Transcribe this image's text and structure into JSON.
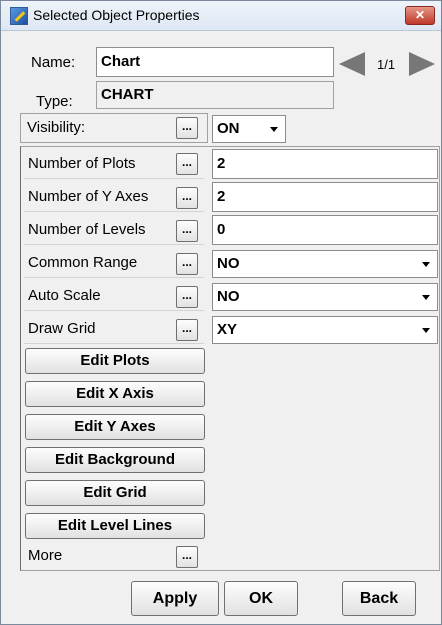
{
  "window": {
    "title": "Selected Object Properties",
    "close_glyph": "✕"
  },
  "name_row": {
    "label": "Name:",
    "value": "Chart",
    "page_indicator": "1/1"
  },
  "type_row": {
    "label": "Type:",
    "value": "CHART"
  },
  "visibility_row": {
    "label": "Visibility:",
    "dots": "...",
    "value": "ON"
  },
  "properties": [
    {
      "label": "Number of Plots",
      "dots": "...",
      "value": "2",
      "kind": "text"
    },
    {
      "label": "Number of Y Axes",
      "dots": "...",
      "value": "2",
      "kind": "text"
    },
    {
      "label": "Number of Levels",
      "dots": "...",
      "value": "0",
      "kind": "text"
    },
    {
      "label": "Common Range",
      "dots": "...",
      "value": "NO",
      "kind": "combo"
    },
    {
      "label": "Auto Scale",
      "dots": "...",
      "value": "NO",
      "kind": "combo"
    },
    {
      "label": "Draw Grid",
      "dots": "...",
      "value": "XY",
      "kind": "combo"
    }
  ],
  "action_buttons": [
    "Edit Plots",
    "Edit X Axis",
    "Edit Y Axes",
    "Edit Background",
    "Edit Grid",
    "Edit Level Lines"
  ],
  "more_row": {
    "label": "More",
    "dots": "..."
  },
  "footer": {
    "apply": "Apply",
    "ok": "OK",
    "back": "Back"
  }
}
